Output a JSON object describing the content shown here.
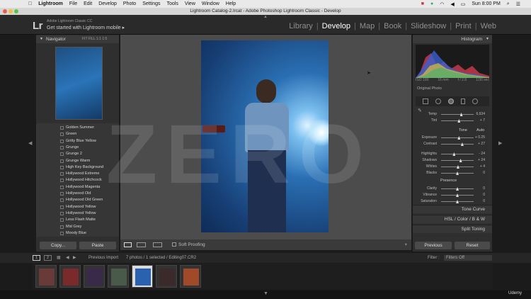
{
  "mac_menu": {
    "apple": "",
    "items": [
      "Lightroom",
      "File",
      "Edit",
      "Develop",
      "Photo",
      "Settings",
      "Tools",
      "View",
      "Window",
      "Help"
    ],
    "clock": "Sun 8:00 PM"
  },
  "window_title": "Lightroom Catalog-2.lrcat - Adobe Photoshop Lightroom Classic - Develop",
  "identity_plate": {
    "logo": "Lr",
    "app_name": "Adobe Lightroom Classic CC",
    "get_started": "Get started with Lightroom mobile ▸"
  },
  "modules": [
    "Library",
    "Develop",
    "Map",
    "Book",
    "Slideshow",
    "Print",
    "Web"
  ],
  "active_module": "Develop",
  "left_panel": {
    "navigator_title": "Navigator",
    "zoom_options": "FIT  FILL  1:1  1:5",
    "presets": [
      "Golden Summer",
      "Green",
      "Gritty Blue Yellow",
      "Grunge",
      "Grunge 2",
      "Grunge Warm",
      "High Key Background",
      "Hollywood Extreme",
      "Hollywood Hitchcock",
      "Hollywood Magenta",
      "Hollywood Old",
      "Hollywood Old Green",
      "Hollywood Yellow",
      "Hollywood Yellow",
      "Less Flash Matte",
      "Mid Grey",
      "Moody Blue"
    ],
    "copy_label": "Copy...",
    "paste_label": "Paste"
  },
  "toolbar": {
    "soft_proofing": "Soft Proofing"
  },
  "watermark": "ZERO",
  "right_panel": {
    "histogram_title": "Histogram",
    "camera_info": [
      "ISO 100",
      "16 mm",
      "f / 2.8",
      "1/30 sec"
    ],
    "original_photo": "Original Photo",
    "basic_rows": [
      {
        "label": "Temp",
        "value": "6,634",
        "pos": 0.62
      },
      {
        "label": "Tint",
        "value": "+ 7",
        "pos": 0.55
      },
      {
        "label": "Exposure",
        "value": "+ 0.25",
        "pos": 0.55
      },
      {
        "label": "Contrast",
        "value": "+ 27",
        "pos": 0.65
      },
      {
        "label": "Highlights",
        "value": "- 24",
        "pos": 0.4
      },
      {
        "label": "Shadows",
        "value": "+ 24",
        "pos": 0.6
      },
      {
        "label": "Whites",
        "value": "+ 4",
        "pos": 0.52
      },
      {
        "label": "Blacks",
        "value": "0",
        "pos": 0.5
      },
      {
        "label": "Clarity",
        "value": "0",
        "pos": 0.5
      },
      {
        "label": "Vibrance",
        "value": "0",
        "pos": 0.5
      },
      {
        "label": "Saturation",
        "value": "0",
        "pos": 0.5
      }
    ],
    "tone_label": "Tone",
    "auto_label": "Auto",
    "presence_label": "Presence",
    "sections": [
      "Tone Curve",
      "HSL / Color / B & W",
      "Split Toning"
    ],
    "previous_label": "Previous",
    "reset_label": "Reset"
  },
  "filmstrip_bar": {
    "source": "Previous Import",
    "info": "7 photos / 1 selected / Editing07.CR2",
    "filter_label": "Filter :",
    "filter_value": "Filters Off"
  },
  "filmstrip_count": 7,
  "selected_index": 4,
  "udemy": "Udemy"
}
